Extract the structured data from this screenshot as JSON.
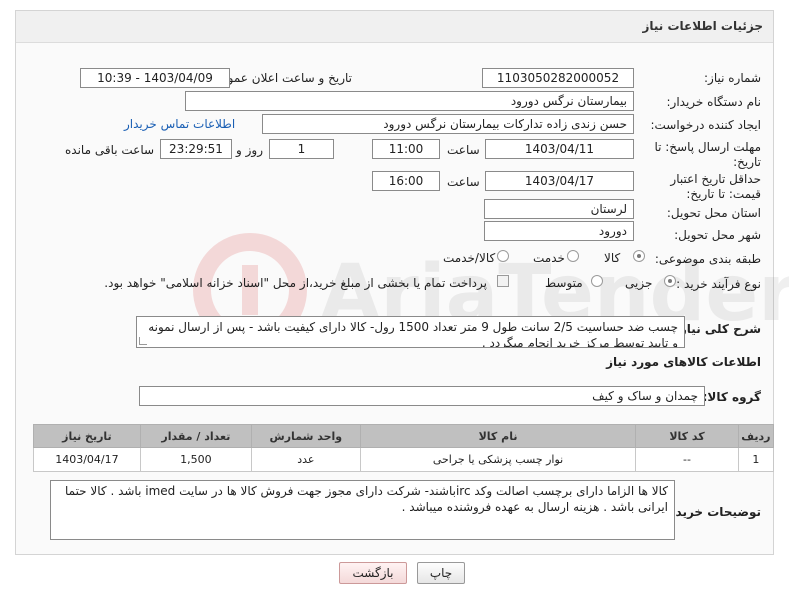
{
  "header": {
    "title": "جزئیات اطلاعات نیاز"
  },
  "fields": {
    "need_number_label": "شماره نیاز:",
    "need_number": "1103050282000052",
    "announce_label": "تاریخ و ساعت اعلان عمومی:",
    "announce_value": "1403/04/09 - 10:39",
    "buyer_org_label": "نام دستگاه خریدار:",
    "buyer_org": "بیمارستان نرگس دورود",
    "requester_label": "ایجاد کننده درخواست:",
    "requester": "حسن  زندی زاده  تدارکات بیمارستان نرگس دورود",
    "contact_link": "اطلاعات تماس خریدار",
    "reply_deadline_label": "مهلت ارسال پاسخ: تا تاریخ:",
    "reply_date": "1403/04/11",
    "time_label": "ساعت",
    "reply_time": "11:00",
    "days_value": "1",
    "days_and_label": "روز و",
    "remaining_time": "23:29:51",
    "remaining_label": "ساعت باقی مانده",
    "price_validity_label": "حداقل تاریخ اعتبار قیمت: تا تاریخ:",
    "validity_date": "1403/04/17",
    "validity_time": "16:00",
    "province_label": "استان محل تحویل:",
    "province": "لرستان",
    "city_label": "شهر محل تحویل:",
    "city": "دورود",
    "category_label": "طبقه بندی موضوعی:",
    "category_options": [
      "کالا",
      "خدمت",
      "کالا/خدمت"
    ],
    "process_label": "نوع فرآیند خرید :",
    "process_options": [
      "جزیی",
      "متوسط"
    ],
    "payment_note": "پرداخت تمام یا بخشی از مبلغ خرید،از محل \"اسناد خزانه اسلامی\" خواهد بود."
  },
  "description": {
    "label": "شرح کلی نیاز:",
    "text": "چسب ضد حساسیت 2/5 سانت طول 9 متر تعداد 1500 رول- کالا دارای کیفیت باشد - پس از ارسال نمونه و تایید توسط مرکز خرید انجام میگردد ."
  },
  "goods_section": {
    "title": "اطلاعات کالاهای مورد نیاز",
    "group_label": "گروه کالا:",
    "group_value": "چمدان و ساک و کیف"
  },
  "table": {
    "headers": [
      "ردیف",
      "کد کالا",
      "نام کالا",
      "واحد شمارش",
      "تعداد / مقدار",
      "تاریخ نیاز"
    ],
    "rows": [
      [
        "1",
        "--",
        "نوار چسب پزشکی یا جراحی",
        "عدد",
        "1,500",
        "1403/04/17"
      ]
    ]
  },
  "buyer_notes": {
    "label": "توضیحات خریدار:",
    "text": "کالا ها الزاما دارای برچسب اصالت وکد ircباشند- شرکت دارای مجوز جهت فروش کالا ها در سایت imed باشد . کالا حتما ایرانی باشد . هزینه ارسال به عهده فروشنده میباشد ."
  },
  "buttons": {
    "print": "چاپ",
    "back": "بازگشت"
  },
  "colors": {
    "link": "#1a5fb4",
    "table_header": "#c0c0c0",
    "back_button": "#f4d9d9"
  }
}
